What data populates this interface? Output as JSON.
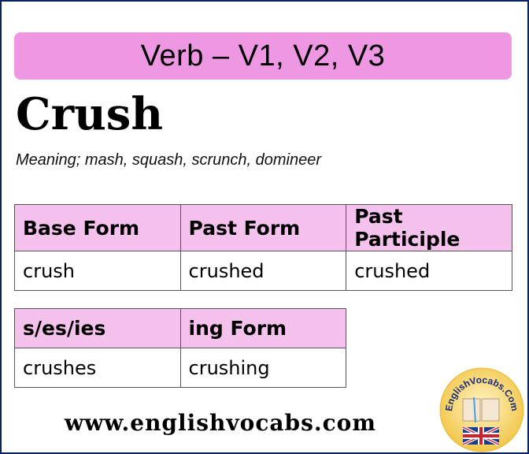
{
  "header": {
    "title": "Verb – V1, V2, V3"
  },
  "word": "Crush",
  "meaning": "Meaning; mash, squash, scrunch, domineer",
  "table_main": {
    "headers": [
      "Base Form",
      "Past Form",
      "Past Participle"
    ],
    "row": [
      "crush",
      "crushed",
      "crushed"
    ]
  },
  "table_extra": {
    "headers": [
      "s/es/ies",
      "ing Form"
    ],
    "row": [
      "crushes",
      "crushing"
    ]
  },
  "footer": {
    "url": "www.englishvocabs.com"
  },
  "logo": {
    "text": "EnglishVocabs.Com"
  },
  "colors": {
    "banner": "#ee97e2",
    "table_header": "#f5c2ee",
    "border": "#0a2460"
  }
}
